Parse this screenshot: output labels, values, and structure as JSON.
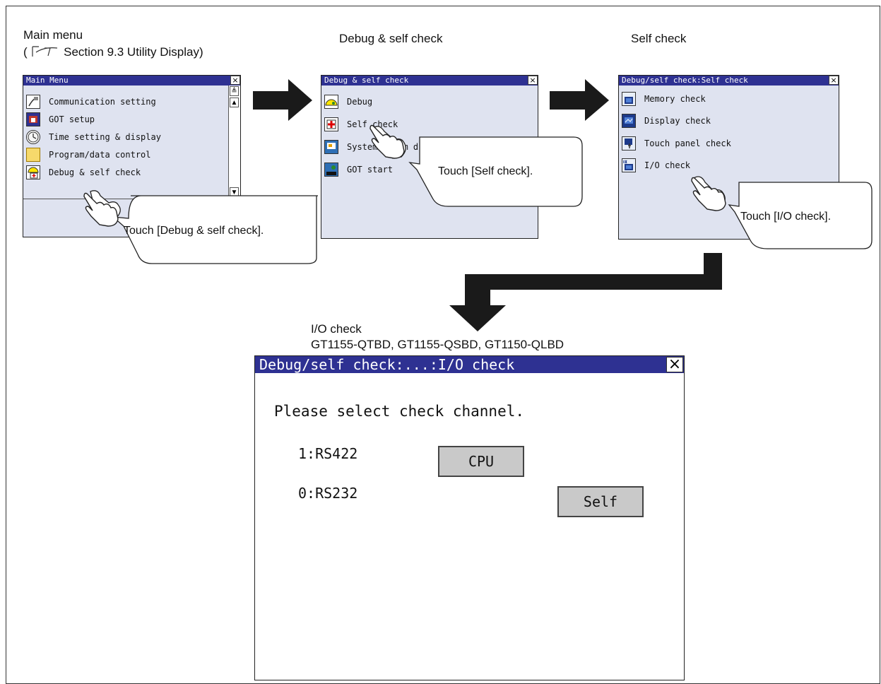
{
  "captions": {
    "main_menu": "Main menu",
    "reference_open": "(",
    "reference_text": "Section 9.3 Utility Display)",
    "debug_self_check": "Debug & self check",
    "self_check": "Self check",
    "io_check": "I/O check",
    "models": "GT1155-QTBD, GT1155-QSBD, GT1150-QLBD"
  },
  "screen1": {
    "title": "Main Menu",
    "close": "×",
    "items": [
      {
        "label": "Communication setting",
        "icon": "communication-icon"
      },
      {
        "label": "GOT setup",
        "icon": "got-setup-icon"
      },
      {
        "label": "Time setting & display",
        "icon": "clock-icon"
      },
      {
        "label": "Program/data control",
        "icon": "folder-icon"
      },
      {
        "label": "Debug & self check",
        "icon": "debug-icon"
      }
    ],
    "scroll_up": "▲",
    "scroll_down": "▼",
    "scroll_top": "≜"
  },
  "screen2": {
    "title": "Debug & self check",
    "close": "×",
    "items": [
      {
        "label": "Debug",
        "icon": "debug-icon"
      },
      {
        "label": "Self check",
        "icon": "self-check-icon"
      },
      {
        "label": "System alarm d",
        "icon": "system-alarm-icon"
      },
      {
        "label": "GOT start",
        "icon": "got-start-icon"
      }
    ]
  },
  "screen3": {
    "title": "Debug/self check:Self check",
    "close": "×",
    "items": [
      {
        "label": "Memory check",
        "icon": "memory-icon"
      },
      {
        "label": "Display check",
        "icon": "display-icon"
      },
      {
        "label": "Touch panel check",
        "icon": "touch-panel-icon"
      },
      {
        "label": "I/O check",
        "icon": "io-icon"
      }
    ]
  },
  "callouts": {
    "c1": "Touch [Debug & self check].",
    "c2": "Touch [Self check].",
    "c3": "Touch [I/O check]."
  },
  "io_screen": {
    "title": "Debug/self check:...:I/O check",
    "close": "×",
    "prompt": "Please select check channel.",
    "ch1": "1:RS422",
    "ch0": "0:RS232",
    "cpu_button": "CPU",
    "self_button": "Self"
  },
  "colors": {
    "titlebar": "#2e3192",
    "screen_bg": "#dfe3f0",
    "button_gray": "#c9c9c9"
  }
}
